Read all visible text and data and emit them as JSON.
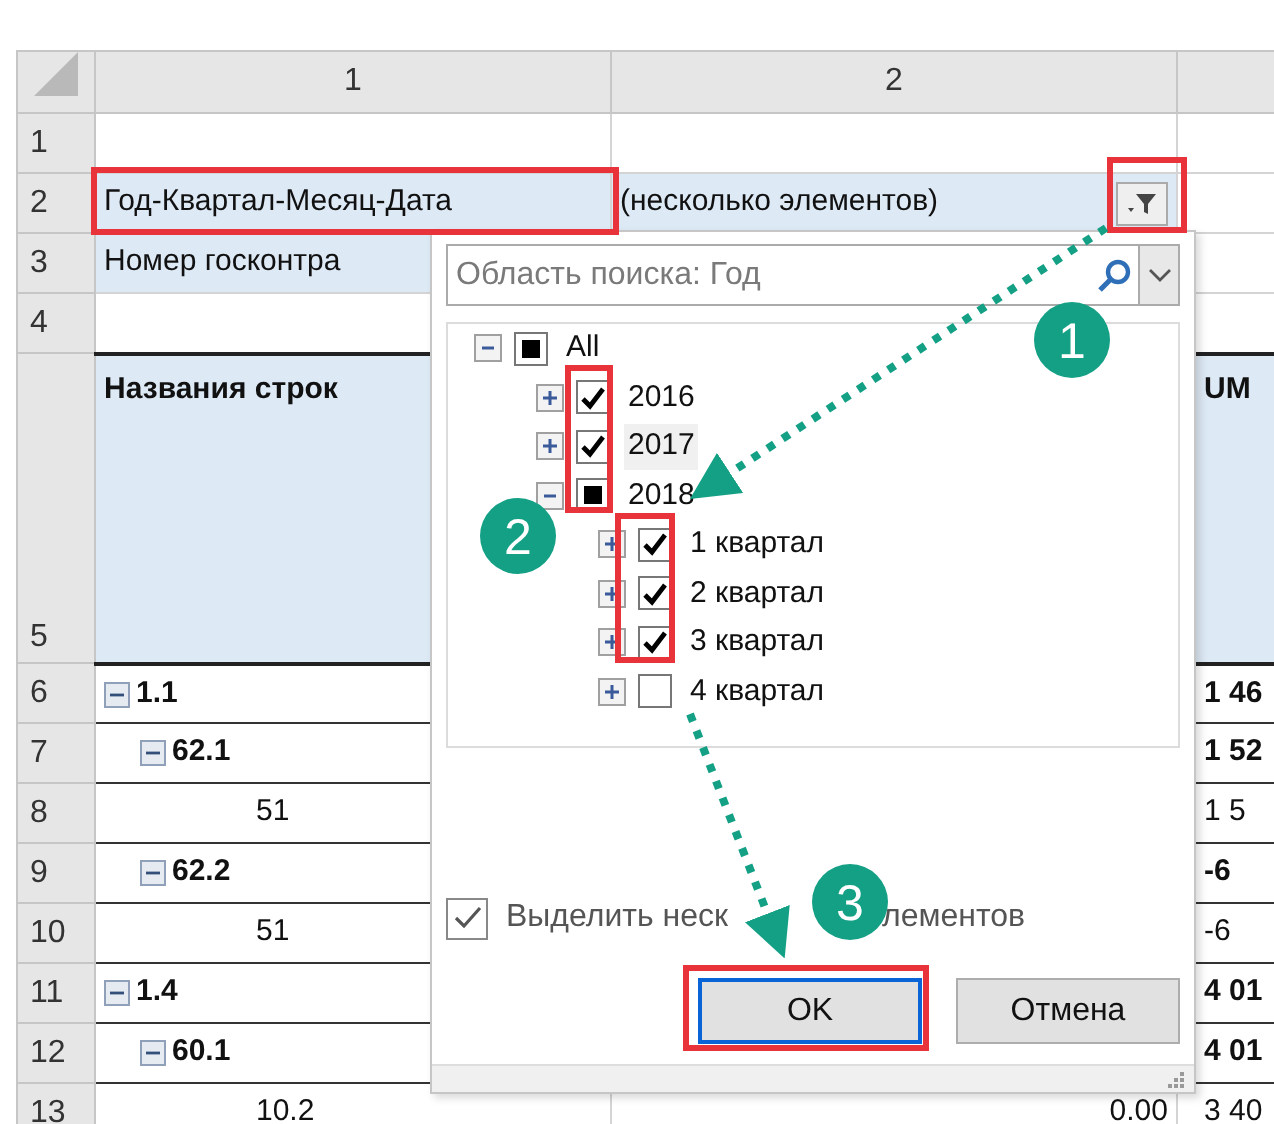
{
  "column_headers": [
    "1",
    "2"
  ],
  "sheet_rows": [
    {
      "kind": "blank",
      "number": "1"
    },
    {
      "kind": "filter",
      "number": "2",
      "field": "Год-Квартал-Месяц-Дата",
      "value": "(несколько элементов)"
    },
    {
      "kind": "filter",
      "number": "3",
      "field": "Номер госконтра"
    },
    {
      "kind": "blank",
      "number": "4"
    },
    {
      "kind": "header",
      "number": "5",
      "label": "Названия строк",
      "column_3": "UM"
    }
  ],
  "pivot_rows": [
    {
      "number": "6",
      "label": "1.1",
      "expanded": true,
      "column_3": "1 46",
      "children": [
        {
          "number": "7",
          "label": "62.1",
          "expanded": true,
          "column_3": "1 52",
          "children": [
            {
              "number": "8",
              "label": "51",
              "column_3": "1 5"
            }
          ]
        },
        {
          "number": "9",
          "label": "62.2",
          "expanded": true,
          "column_3": "-6",
          "children": [
            {
              "number": "10",
              "label": "51",
              "column_3": "-6"
            }
          ]
        }
      ]
    },
    {
      "number": "11",
      "label": "1.4",
      "expanded": true,
      "column_3": "4 01",
      "children": [
        {
          "number": "12",
          "label": "60.1",
          "expanded": true,
          "column_3": "4 01",
          "children": [
            {
              "number": "13",
              "label": "10.2",
              "column_2": "0.00",
              "column_3": "3 40"
            }
          ]
        }
      ]
    }
  ],
  "filter_popup": {
    "search": {
      "placeholder": "Область поиска: Год"
    },
    "tree": [
      {
        "label": "All",
        "checked": false,
        "partial": true,
        "expanded": true,
        "highlighted": false,
        "children": [
          {
            "label": "2016",
            "checked": true,
            "partial": false,
            "expanded": false,
            "highlighted": false
          },
          {
            "label": "2017",
            "checked": true,
            "partial": false,
            "expanded": false,
            "highlighted": true
          },
          {
            "label": "2018",
            "checked": false,
            "partial": true,
            "expanded": true,
            "highlighted": false,
            "children": [
              {
                "label": "1 квартал",
                "checked": true,
                "partial": false,
                "expanded": false,
                "highlighted": false
              },
              {
                "label": "2 квартал",
                "checked": true,
                "partial": false,
                "expanded": false,
                "highlighted": false
              },
              {
                "label": "3 квартал",
                "checked": true,
                "partial": false,
                "expanded": false,
                "highlighted": false
              },
              {
                "label": "4 квартал",
                "checked": false,
                "partial": false,
                "expanded": false,
                "highlighted": false
              }
            ]
          }
        ]
      }
    ],
    "multi_select": {
      "label": "Выделить неск",
      "label_tail": "лементов",
      "checked": true
    },
    "buttons": [
      {
        "label": "OK",
        "focused": true
      },
      {
        "label": "Отмена",
        "focused": false
      }
    ]
  },
  "callouts": [
    {
      "label": "1"
    },
    {
      "label": "2"
    },
    {
      "label": "3"
    }
  ]
}
